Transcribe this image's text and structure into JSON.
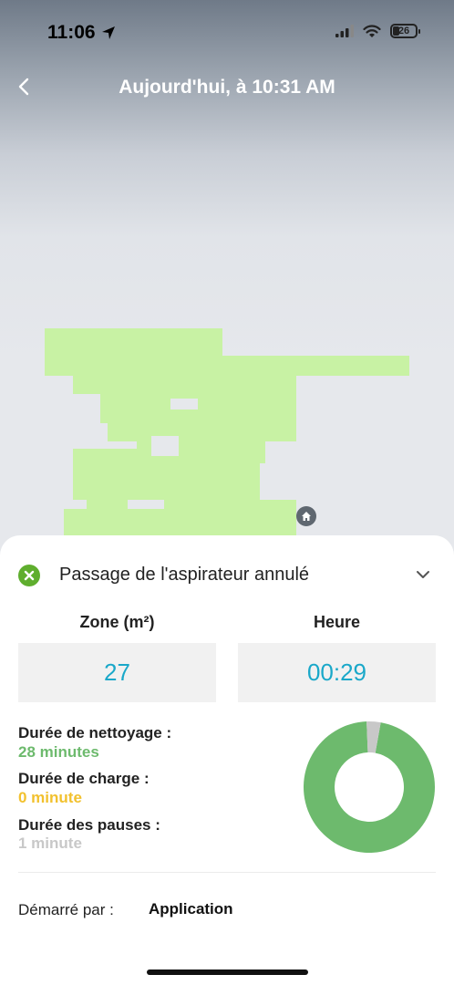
{
  "status_bar": {
    "time": "11:06",
    "battery": "26"
  },
  "header": {
    "title": "Aujourd'hui, à 10:31 AM"
  },
  "status": {
    "text": "Passage de l'aspirateur annulé"
  },
  "stats": {
    "zone_label": "Zone (m²)",
    "zone_value": "27",
    "time_label": "Heure",
    "time_value": "00:29"
  },
  "durations": {
    "cleaning_label": "Durée de nettoyage :",
    "cleaning_value": "28 minutes",
    "charge_label": "Durée de charge :",
    "charge_value": "0 minute",
    "pause_label": "Durée des pauses :",
    "pause_value": "1 minute"
  },
  "chart_data": {
    "type": "pie",
    "categories": [
      "Durée de nettoyage",
      "Durée de charge",
      "Durée des pauses"
    ],
    "values": [
      28,
      0,
      1
    ]
  },
  "started": {
    "label": "Démarré par :",
    "value": "Application"
  },
  "colors": {
    "accent": "#1aa8c9",
    "cleaning": "#6dba6d",
    "charge": "#f2c12e",
    "pause": "#c8c8c8",
    "map": "#c8f2a4",
    "success": "#5fae2e"
  },
  "icons": {
    "back": "chevron-left-icon",
    "location": "location-arrow-icon",
    "home": "home-icon",
    "status": "check-circle-icon",
    "expand": "chevron-down-icon"
  }
}
